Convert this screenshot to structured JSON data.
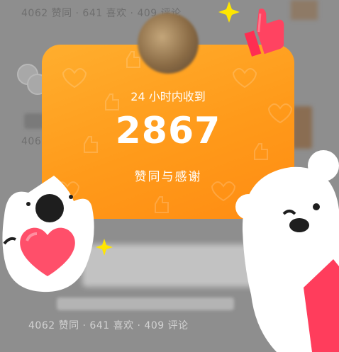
{
  "feed": {
    "top_stats": "4062 赞同 · 641 喜欢 · 409 评论",
    "mid_stats": "406",
    "bottom_stats": "4062 赞同 · 641 喜欢 · 409 评论"
  },
  "popup": {
    "caption": "24 小时内收到",
    "count": "2867",
    "label": "赞同与感谢"
  },
  "colors": {
    "popup_accent": "#ff9a1a",
    "thumbs_icon": "#ff3d5c",
    "heart_icon": "#ff4f6a",
    "star_icon": "#ffe600"
  },
  "icons": [
    "sparkle-star-icon",
    "thumbs-up-icon",
    "heart-icon",
    "mascot-cat",
    "mascot-bear"
  ]
}
